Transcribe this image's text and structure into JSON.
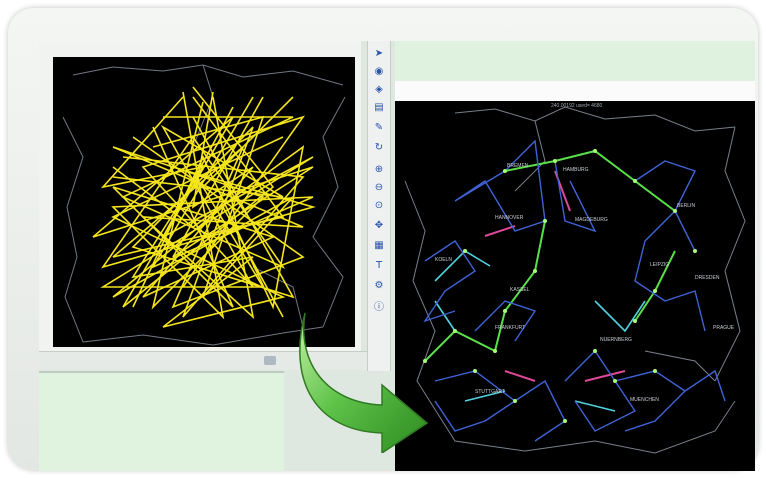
{
  "left_panel": {
    "status_text": "",
    "label_tl": "",
    "city_labels": []
  },
  "right_panel": {
    "caption": "240.00192 used= 4680",
    "city_labels": [
      "BREMEN",
      "HAMBURG",
      "BERLIN",
      "HANNOVER",
      "MAGDEBURG",
      "LEIPZIG",
      "DRESDEN",
      "KASSEL",
      "KOELN",
      "FRANKFURT",
      "NUERNBERG",
      "PRAGUE",
      "MUENCHEN",
      "STUTTGART"
    ]
  },
  "toolbar": {
    "icons": [
      "cursor-icon",
      "globe-icon",
      "layers-icon",
      "filter-icon",
      "edit-icon",
      "refresh-icon",
      "zoom-in-icon",
      "zoom-out-icon",
      "zoom-fit-icon",
      "pan-icon",
      "table-icon",
      "text-icon",
      "settings-icon",
      "info-icon"
    ]
  },
  "colors": {
    "traffic_lines": "#f5e51c",
    "network_blue": "#3f63d6",
    "network_green": "#59e04a",
    "network_cyan": "#4fd4df",
    "network_magenta": "#e0489a",
    "arrow_green": "#3fa82d"
  }
}
